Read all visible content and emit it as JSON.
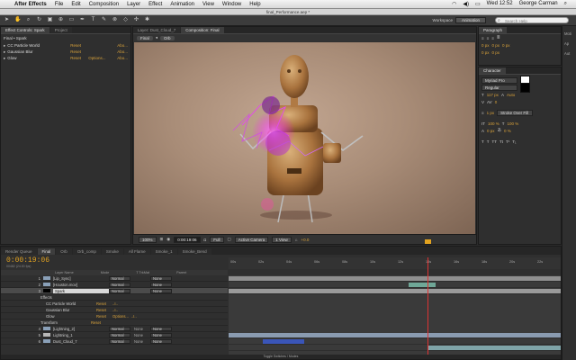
{
  "menubar": {
    "app_name": "After Effects",
    "items": [
      "File",
      "Edit",
      "Composition",
      "Layer",
      "Effect",
      "Animation",
      "View",
      "Window",
      "Help"
    ],
    "clock": "Wed 12:52",
    "user": "George Carman"
  },
  "window_title": "final_Performance.aep *",
  "toolbar": {
    "workspace_label": "Workspace",
    "workspace_value": "Animation",
    "search_placeholder": "Search Help"
  },
  "effect_controls": {
    "tabs": [
      "Effect Controls: Spark",
      "Project"
    ],
    "header": "Final • Spark",
    "effects": [
      {
        "name": "CC Particle World",
        "reset": "Reset",
        "about": "Abo..."
      },
      {
        "name": "Gaussian Blur",
        "reset": "Reset",
        "about": "Abo..."
      },
      {
        "name": "Glow",
        "reset": "Reset",
        "extra": "Options...",
        "about": "Abo..."
      }
    ]
  },
  "viewer": {
    "tabs": [
      "Layer: Dust_Cloud_7",
      "Composition: Final"
    ],
    "crumbs": [
      "Final",
      "Orb"
    ],
    "zoom": "100%",
    "timecode": "0:00:19:06",
    "resolution": "Full",
    "camera": "Active Camera",
    "views": "1 View",
    "exposure": "+0.0"
  },
  "paragraph": {
    "title": "Paragraph",
    "values": [
      "0 px",
      "0 px",
      "0 px",
      "0 px",
      "0 px"
    ]
  },
  "character": {
    "title": "Character",
    "font": "Myriad Pro",
    "style": "Regular",
    "size": "117 px",
    "leading": "Auto",
    "tracking": "0",
    "stroke": "1 px",
    "stroke_type": "Stroke Over Fill",
    "vscale": "100 %",
    "hscale": "100 %",
    "baseline": "0 px",
    "tsume": "0 %",
    "fill_color": "#ffffff",
    "stroke_color": "#000000"
  },
  "timeline": {
    "tabs": [
      "Render Queue",
      "Final",
      "Orb",
      "Orb_comp",
      "Smoke",
      "All Flame",
      "Smoke_1",
      "Smoke_Bend"
    ],
    "time": "0:00:19:06",
    "fps": "00482 (24.00 fps)",
    "headers": [
      "Layer Name",
      "Mode",
      "T TrkMat",
      "Parent"
    ],
    "ruler": [
      "00s",
      "02s",
      "04s",
      "06s",
      "08s",
      "10s",
      "12s",
      "14s",
      "16s",
      "18s",
      "20s",
      "22s"
    ],
    "layers": [
      {
        "idx": "1",
        "name": "[Lip_Sync]",
        "mode": "Normal",
        "parent": "None",
        "color": "#8aa0b8"
      },
      {
        "idx": "2",
        "name": "[Houston.mov]",
        "mode": "Normal",
        "parent": "None",
        "color": "#8aa0b8"
      },
      {
        "idx": "3",
        "name": "Spark",
        "mode": "Normal",
        "parent": "None",
        "color": "#000000"
      }
    ],
    "fx_rows": [
      {
        "name": "Effects"
      },
      {
        "name": "CC Particle World",
        "reset": "Reset"
      },
      {
        "name": "Gaussian Blur",
        "reset": "Reset"
      },
      {
        "name": "Glow",
        "reset": "Reset",
        "extra": "Options..."
      },
      {
        "name": "Transform",
        "reset": "Reset"
      }
    ],
    "lower_layers": [
      {
        "idx": "4",
        "name": "[Lightning_2]",
        "mode": "Normal",
        "trk": "None",
        "parent": "None"
      },
      {
        "idx": "5",
        "name": "Lightning_1",
        "mode": "Normal",
        "trk": "None",
        "parent": "None"
      },
      {
        "idx": "6",
        "name": "Dust_Cloud_7",
        "mode": "Normal",
        "trk": "None",
        "parent": "None"
      }
    ],
    "footer": "Toggle Switches / Modes"
  }
}
